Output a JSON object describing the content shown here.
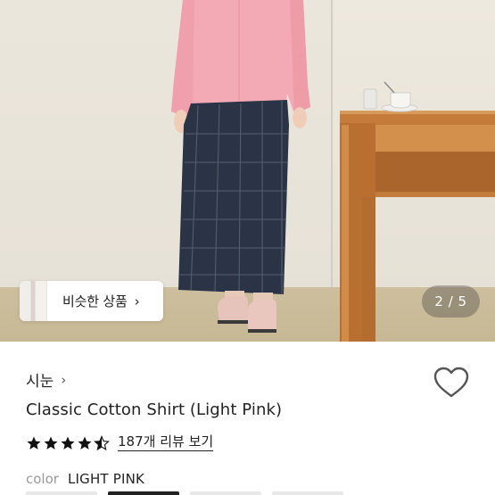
{
  "similar_products": {
    "label": "비슷한 상품",
    "chevron": "›"
  },
  "gallery": {
    "pager": "2 / 5"
  },
  "product": {
    "brand": "시눈",
    "brand_chevron": "›",
    "title": "Classic Cotton Shirt (Light Pink)",
    "rating": 4.5,
    "review_link": "187개 리뷰 보기",
    "color_label": "color",
    "color_value": "LIGHT PINK"
  },
  "icons": {
    "wishlist": "heart-icon",
    "star_full": "star-icon",
    "star_half": "half-star-icon",
    "chevron": "chevron-right-icon"
  },
  "colors": {
    "text": "#222222",
    "muted": "#999999",
    "star": "#111111",
    "pager_bg": "rgba(60,60,60,0.35)",
    "shirt": "#f2a7b2",
    "skirt": "#2c3548",
    "desk": "#c8823f"
  }
}
